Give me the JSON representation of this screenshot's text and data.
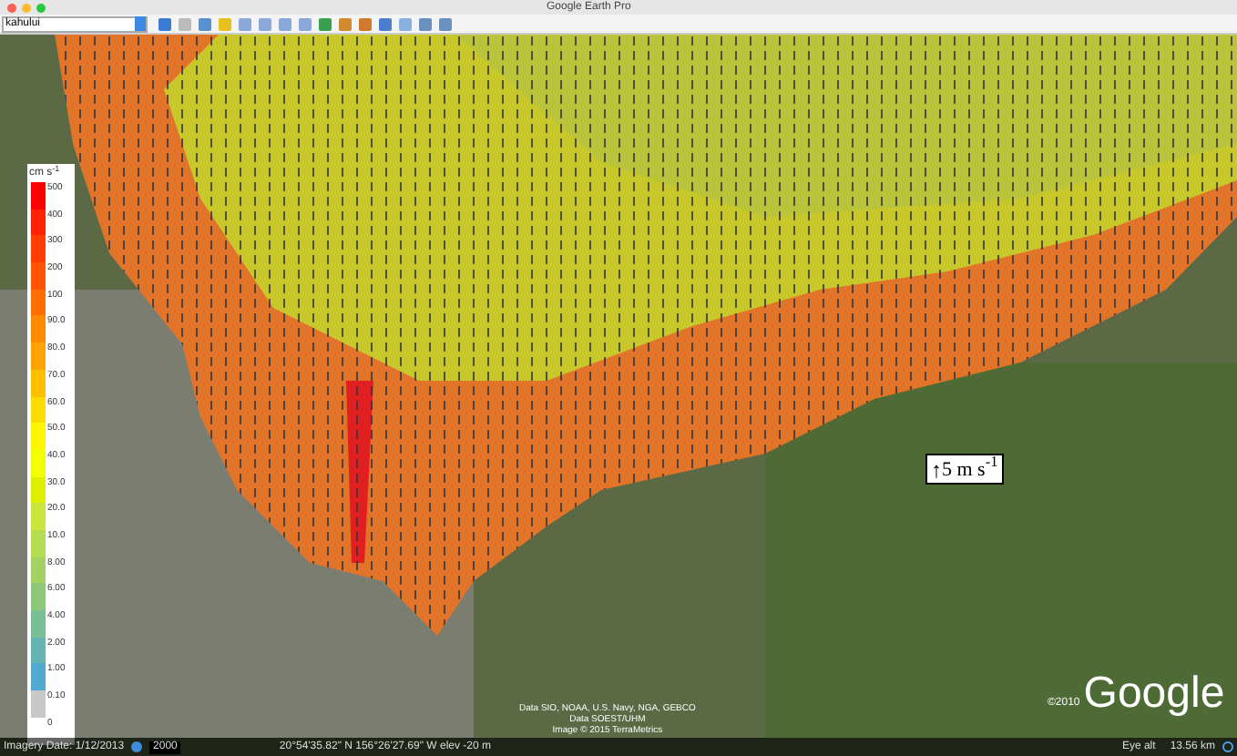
{
  "window": {
    "title": "Google Earth Pro"
  },
  "search": {
    "value": "kahului"
  },
  "legend": {
    "unit": "cm s$^{-1}$",
    "items": [
      {
        "label": "500",
        "color": "#ff0000"
      },
      {
        "label": "400",
        "color": "#ff2200"
      },
      {
        "label": "300",
        "color": "#ff3d00"
      },
      {
        "label": "200",
        "color": "#ff5500"
      },
      {
        "label": "100",
        "color": "#ff6e00"
      },
      {
        "label": "90.0",
        "color": "#ff8a00"
      },
      {
        "label": "80.0",
        "color": "#ffa400"
      },
      {
        "label": "70.0",
        "color": "#ffc000"
      },
      {
        "label": "60.0",
        "color": "#ffdc00"
      },
      {
        "label": "50.0",
        "color": "#fff500"
      },
      {
        "label": "40.0",
        "color": "#f2ff00"
      },
      {
        "label": "30.0",
        "color": "#dcf000"
      },
      {
        "label": "20.0",
        "color": "#c8e63c"
      },
      {
        "label": "10.0",
        "color": "#b4dc50"
      },
      {
        "label": "8.00",
        "color": "#a0d264"
      },
      {
        "label": "6.00",
        "color": "#8cc878"
      },
      {
        "label": "4.00",
        "color": "#78be96"
      },
      {
        "label": "2.00",
        "color": "#64b4b4"
      },
      {
        "label": "1.00",
        "color": "#50aad2"
      },
      {
        "label": "0.10",
        "color": "#c8c8c8"
      },
      {
        "label": "0"
      }
    ]
  },
  "scale": {
    "arrow": "↑",
    "text": "5 m s$^{-1}$"
  },
  "attribution": [
    "Data SIO, NOAA, U.S. Navy, NGA, GEBCO",
    "Data SOEST/UHM",
    "Image © 2015 TerraMetrics"
  ],
  "copyright": "©2010",
  "logo": "Google",
  "status_bar": {
    "imagery_date": "Imagery Date: 1/12/2013",
    "year": "2000",
    "coordinates": "20°54'35.82\" N 156°26'27.69\" W elev  -20 m",
    "eye_alt_label": "Eye alt",
    "eye_alt": "13.56 km"
  }
}
